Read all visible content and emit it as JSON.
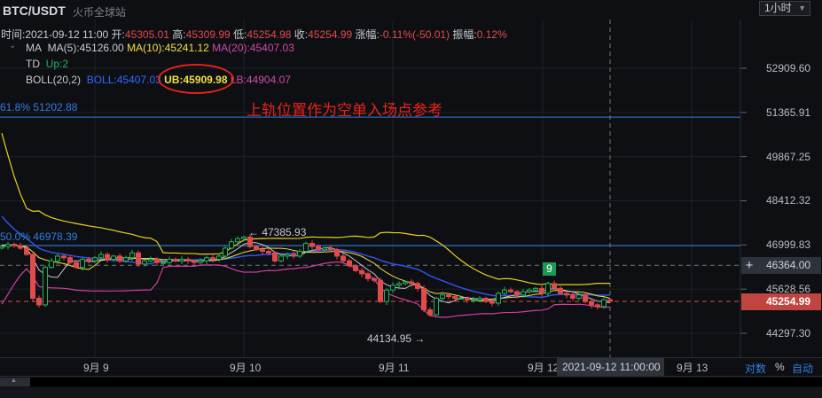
{
  "header": {
    "symbol": "BTC/USDT",
    "exchange": "火币全球站",
    "timeframe": "1小时"
  },
  "ohlc": {
    "time_label": "时间:",
    "time": "2021-09-12 11:00",
    "open_label": "开:",
    "open": "45305.01",
    "high_label": "高:",
    "high": "45309.99",
    "low_label": "低:",
    "low": "45254.98",
    "close_label": "收:",
    "close": "45254.99",
    "change_label": "涨幅:",
    "change": "-0.11%(-50.01)",
    "amp_label": "振幅:",
    "amp": "0.12%"
  },
  "indicators": {
    "ma": {
      "name": "MA",
      "ma5": "MA(5):45126.00",
      "ma10": "MA(10):45241.12",
      "ma20": "MA(20):45407.03"
    },
    "td": {
      "name": "TD",
      "value": "Up:2"
    },
    "boll": {
      "name": "BOLL(20,2)",
      "mid": "BOLL:45407.03",
      "ub": "UB:45909.98",
      "lb": "LB:44904.07"
    }
  },
  "annotation": "上轨位置作为空单入场点参考",
  "fib": [
    {
      "label": "61.8% 51202.88",
      "price": 51202.88
    },
    {
      "label": "50.0% 46978.39",
      "price": 46978.39
    }
  ],
  "price_axis": [
    "52909.60",
    "51365.91",
    "49867.25",
    "48412.32",
    "46999.83",
    "45628.56",
    "44297.30"
  ],
  "price_axis_values": [
    52909.6,
    51365.91,
    49867.25,
    48412.32,
    46999.83,
    45628.56,
    44297.3
  ],
  "crosshair_price": "46364.00",
  "crosshair_value": 46364.0,
  "last_price": "45254.99",
  "last_value": 45254.99,
  "high_marker": "← 47385.93",
  "low_marker": "44134.95 →",
  "td_marker": "9",
  "x_axis": [
    "9月 9",
    "9月 10",
    "9月 11",
    "9月 12",
    "9月 13"
  ],
  "crosshair_time": "2021-09-12 11:00:00",
  "footer": {
    "log": "对数",
    "pct": "%",
    "auto": "自动"
  },
  "colors": {
    "up": "#22b35a",
    "down": "#e04b4b",
    "ma5": "#c8cad0",
    "ma10": "#f0e040",
    "ma20": "#d04aa8",
    "boll": "#2f54e8",
    "fib": "#2f7fe0"
  },
  "chart_data": {
    "type": "candlestick",
    "interval": "1h",
    "start": "2021-09-08 09:00",
    "end": "2021-09-12 11:00",
    "close": [
      46950,
      47020,
      46980,
      46900,
      46700,
      45350,
      45150,
      46300,
      46500,
      46650,
      46600,
      46450,
      46300,
      46550,
      46500,
      46600,
      46700,
      46550,
      46650,
      46500,
      46600,
      46750,
      46400,
      46500,
      46550,
      46450,
      46450,
      46550,
      46500,
      46550,
      46500,
      46450,
      46500,
      46600,
      46550,
      46650,
      46900,
      47100,
      47200,
      47250,
      46950,
      46850,
      46800,
      46750,
      46500,
      46650,
      46700,
      46650,
      46800,
      47050,
      46950,
      46850,
      46900,
      46850,
      46650,
      46500,
      46350,
      46200,
      46100,
      45950,
      45900,
      45250,
      45600,
      45750,
      45800,
      45850,
      45800,
      45650,
      45000,
      44850,
      45350,
      45450,
      45400,
      45350,
      45350,
      45300,
      45300,
      45350,
      45250,
      45200,
      45500,
      45600,
      45550,
      45450,
      45550,
      45600,
      45650,
      45500,
      45800,
      45650,
      45500,
      45450,
      45350,
      45450,
      45250,
      45150,
      45100,
      45305,
      45254.99
    ]
  }
}
